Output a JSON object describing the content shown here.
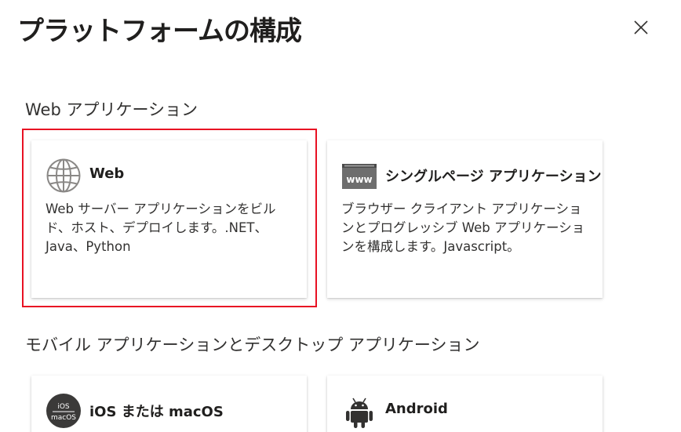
{
  "dialog": {
    "title": "プラットフォームの構成",
    "close_icon": "close-icon"
  },
  "sections": {
    "web": {
      "heading": "Web アプリケーション",
      "cards": {
        "web": {
          "icon": "globe-icon",
          "title": "Web",
          "description": "Web サーバー アプリケーションをビルド、ホスト、デプロイします。.NET、Java、Python",
          "selected": true
        },
        "spa": {
          "icon": "www-icon",
          "icon_text": "www",
          "title": "シングルページ アプリケーション",
          "description": "ブラウザー クライアント アプリケーションとプログレッシブ Web アプリケーションを構成します。Javascript。",
          "selected": false
        }
      }
    },
    "mobile": {
      "heading": "モバイル アプリケーションとデスクトップ アプリケーション",
      "cards": {
        "ios": {
          "icon": "ios-macos-icon",
          "icon_text_top": "iOS",
          "icon_text_bottom": "macOS",
          "title": "iOS または macOS"
        },
        "android": {
          "icon": "android-icon",
          "title": "Android"
        }
      }
    }
  },
  "colors": {
    "selection_outline": "#e81123",
    "icon_gray": "#6e6e6e",
    "ios_badge": "#3b3a39",
    "text_primary": "#201f1e"
  }
}
